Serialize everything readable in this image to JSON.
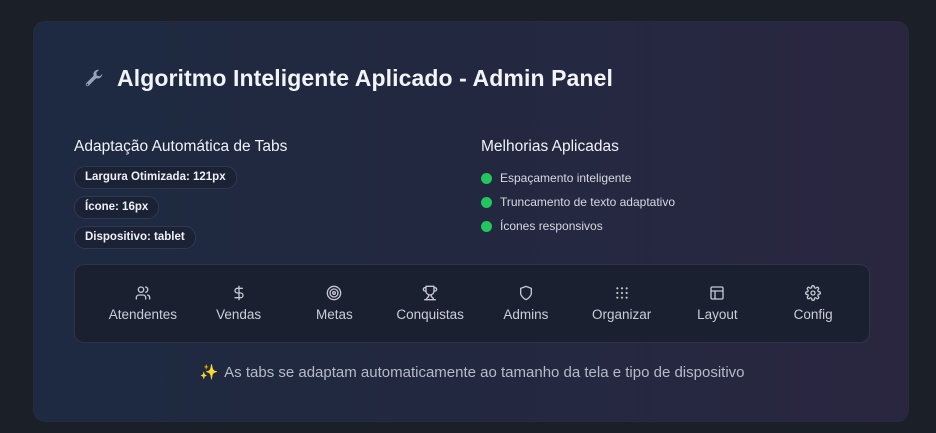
{
  "panel": {
    "title": "Algoritmo Inteligente Aplicado - Admin Panel",
    "title_icon": "wrench-icon"
  },
  "adaptation": {
    "heading": "Adaptação Automática de Tabs",
    "badges": [
      "Largura Otimizada: 121px",
      "Ícone: 16px",
      "Dispositivo: tablet"
    ]
  },
  "improvements": {
    "heading": "Melhorias Aplicadas",
    "items": [
      "Espaçamento inteligente",
      "Truncamento de texto adaptativo",
      "Ícones responsivos"
    ],
    "dot_color": "#22c55e"
  },
  "tabs": [
    {
      "label": "Atendentes",
      "icon": "users-icon"
    },
    {
      "label": "Vendas",
      "icon": "dollar-icon"
    },
    {
      "label": "Metas",
      "icon": "target-icon"
    },
    {
      "label": "Conquistas",
      "icon": "trophy-icon"
    },
    {
      "label": "Admins",
      "icon": "shield-icon"
    },
    {
      "label": "Organizar",
      "icon": "grid-icon"
    },
    {
      "label": "Layout",
      "icon": "layout-icon"
    },
    {
      "label": "Config",
      "icon": "gear-icon"
    }
  ],
  "footer": {
    "note": "As tabs se adaptam automaticamente ao tamanho da tela e tipo de dispositivo",
    "icon": "sparkles-icon"
  }
}
